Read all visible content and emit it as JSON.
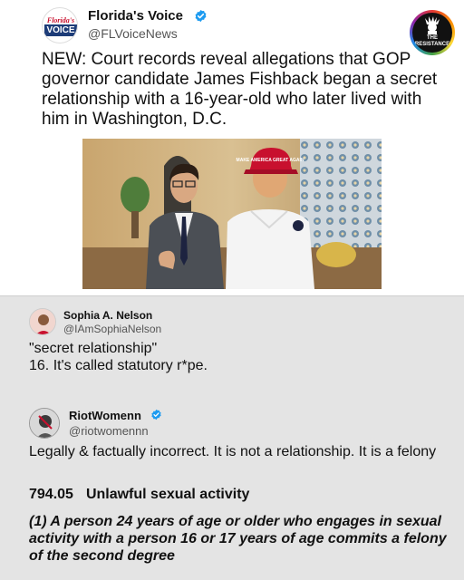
{
  "main_post": {
    "avatar": {
      "line1": "Florida's",
      "line2": "VOICE"
    },
    "name": "Florida's Voice",
    "handle": "@FLVoiceNews",
    "verified": true,
    "text": "NEW: Court records reveal allegations that GOP governor candidate James Fishback began a secret relationship with a 16-year-old who later lived with him in Washington, D.C.",
    "photo": {
      "hat_text": "MAKE AMERICA GREAT AGAIN"
    }
  },
  "corner_badge": {
    "line1": "THE",
    "line2": "RESISTANCE"
  },
  "replies": [
    {
      "name": "Sophia A. Nelson",
      "handle": "@IAmSophiaNelson",
      "verified": false,
      "line1": "\"secret relationship\"",
      "line2": "16. It's called statutory r*pe."
    },
    {
      "name": "RiotWomenn",
      "handle": "@riotwomennn",
      "verified": true,
      "text": "Legally & factually incorrect.  It is not a relationship.  It is a felony",
      "statute_number": "794.05",
      "statute_title": "Unlawful sexual activity",
      "clause": "(1)   A person 24 years of age or older who engages in sexual activity with a person 16 or 17 years of age commits a felony of the second degree"
    }
  ],
  "colors": {
    "verified": "#1d9bf0",
    "reply_background": "#e4e4e4",
    "hat": "#c8102e"
  }
}
